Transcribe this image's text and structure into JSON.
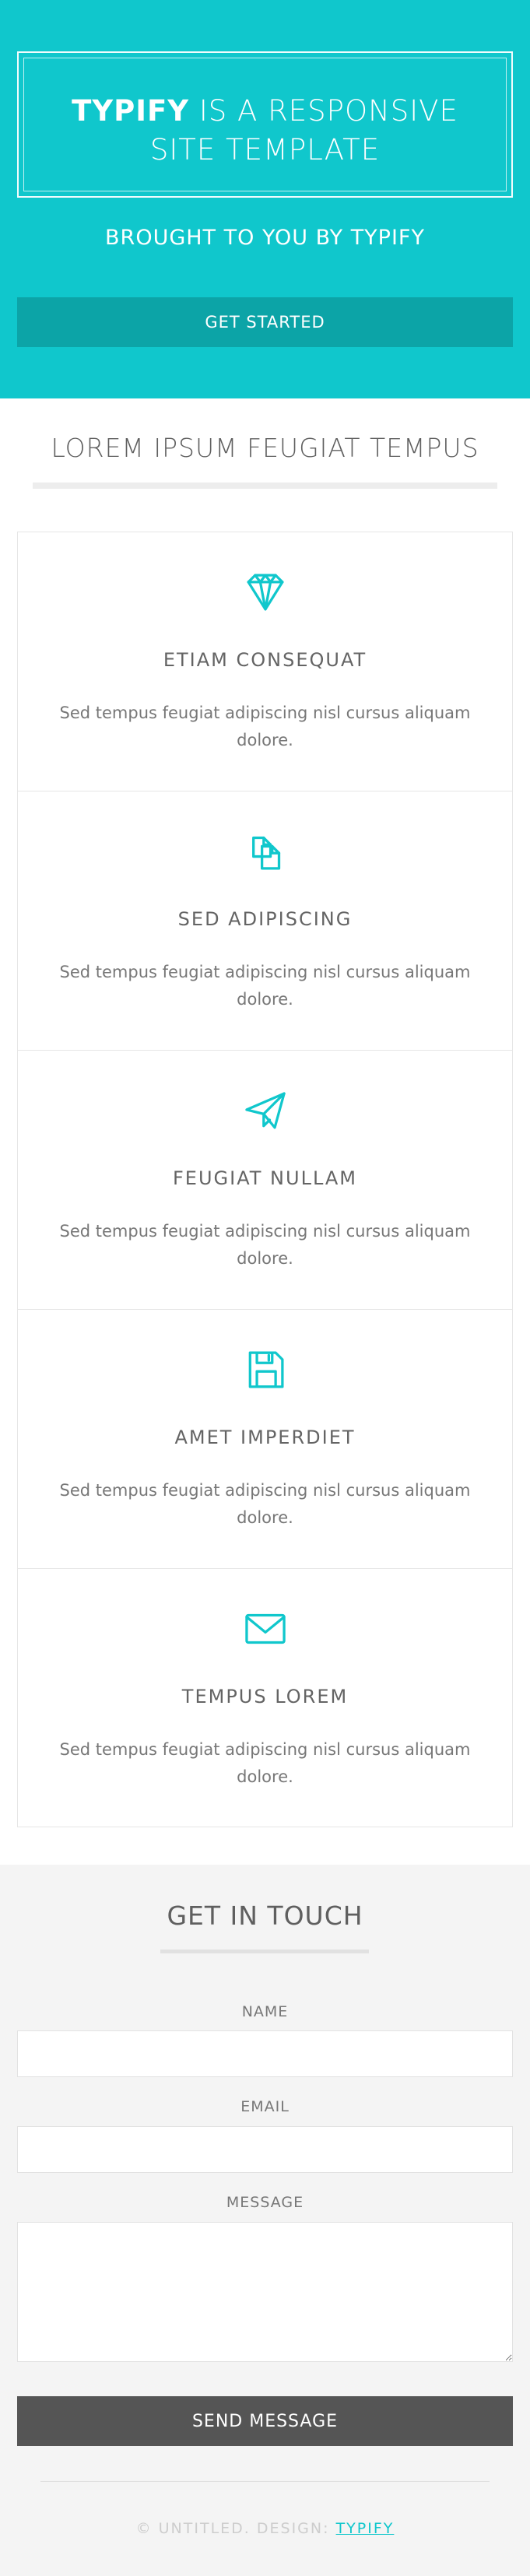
{
  "hero": {
    "brand": "TYPIFY",
    "title_rest": "IS A RESPONSIVE",
    "title_line2": "SITE TEMPLATE",
    "subtitle": "BROUGHT TO YOU BY TYPIFY",
    "button_label": "GET STARTED"
  },
  "section": {
    "title": "LOREM IPSUM FEUGIAT TEMPUS"
  },
  "features": [
    {
      "icon": "diamond-icon",
      "title": "ETIAM CONSEQUAT",
      "text": "Sed tempus feugiat adipiscing nisl cursus aliquam dolore."
    },
    {
      "icon": "copy-icon",
      "title": "SED ADIPISCING",
      "text": "Sed tempus feugiat adipiscing nisl cursus aliquam dolore."
    },
    {
      "icon": "paper-plane-icon",
      "title": "FEUGIAT NULLAM",
      "text": "Sed tempus feugiat adipiscing nisl cursus aliquam dolore."
    },
    {
      "icon": "floppy-disk-icon",
      "title": "AMET IMPERDIET",
      "text": "Sed tempus feugiat adipiscing nisl cursus aliquam dolore."
    },
    {
      "icon": "envelope-icon",
      "title": "TEMPUS LOREM",
      "text": "Sed tempus feugiat adipiscing nisl cursus aliquam dolore."
    }
  ],
  "contact": {
    "title": "GET IN TOUCH",
    "name_label": "NAME",
    "name_value": "",
    "email_label": "EMAIL",
    "email_value": "",
    "message_label": "MESSAGE",
    "message_value": "",
    "send_label": "SEND MESSAGE"
  },
  "footer": {
    "text": "© UNTITLED. DESIGN: ",
    "link": "TYPIFY"
  },
  "colors": {
    "accent": "#10c7cc",
    "button_dark": "#555555",
    "hero_button": "#0ca4a7"
  }
}
